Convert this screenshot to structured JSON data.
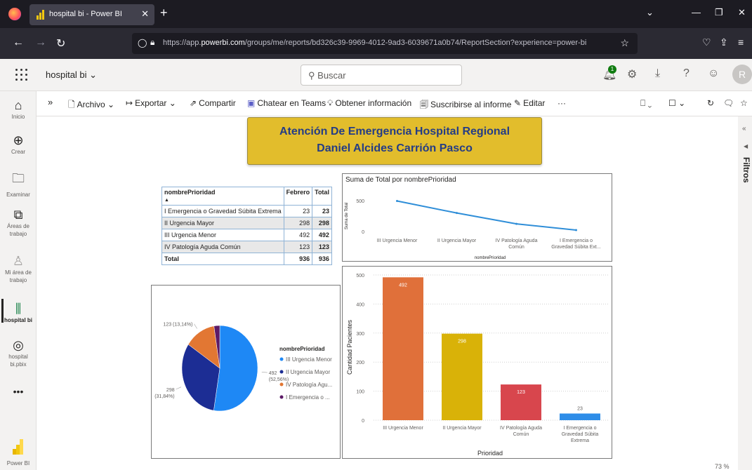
{
  "browser": {
    "tab_title": "hospital bi - Power BI",
    "url_prefix": "https://app.",
    "url_domain": "powerbi.com",
    "url_rest": "/groups/me/reports/bd326c39-9969-4012-9ad3-6039671a0b74/ReportSection?experience=power-bi"
  },
  "pbi": {
    "report_name": "hospital bi",
    "search_placeholder": "Buscar",
    "notification_count": "1",
    "avatar_initial": "R"
  },
  "leftnav": [
    {
      "label": "Inicio",
      "icon": "home-icon"
    },
    {
      "label": "Crear",
      "icon": "plus-icon"
    },
    {
      "label": "Examinar",
      "icon": "folder-icon"
    },
    {
      "label": "Áreas de trabajo",
      "icon": "workspaces-icon"
    },
    {
      "label": "Mi área de trabajo",
      "icon": "person-icon"
    },
    {
      "label": "hospital bi",
      "icon": "report-icon"
    },
    {
      "label": "hospital bi.pbix",
      "icon": "gauge-icon"
    },
    {
      "label": "Power BI",
      "icon": "powerbi-logo"
    }
  ],
  "actions": {
    "archivo": "Archivo",
    "exportar": "Exportar",
    "compartir": "Compartir",
    "teams": "Chatear en Teams",
    "insights": "Obtener información",
    "subscribe": "Suscribirse al informe",
    "edit": "Editar",
    "more": "···"
  },
  "filters_label": "Filtros",
  "report_title": {
    "line1": "Atención De Emergencia Hospital Regional",
    "line2": "Daniel Alcides Carrión Pasco"
  },
  "matrix": {
    "headers": [
      "nombrePrioridad",
      "Febrero",
      "Total"
    ],
    "rows": [
      [
        "I Emergencia o Gravedad Súbita Extrema",
        "23",
        "23"
      ],
      [
        "II Urgencia Mayor",
        "298",
        "298"
      ],
      [
        "III Urgencia Menor",
        "492",
        "492"
      ],
      [
        "IV Patología Aguda Común",
        "123",
        "123"
      ]
    ],
    "total": [
      "Total",
      "936",
      "936"
    ]
  },
  "colors": {
    "bar_iii": "#e0703a",
    "bar_ii": "#d9b208",
    "bar_iv": "#d8464d",
    "bar_i": "#2e8de8",
    "pie_iii": "#1e88f5",
    "pie_ii": "#1c2d94",
    "pie_iv": "#e27733",
    "pie_i": "#5c1a66",
    "line": "#2f8ed8"
  },
  "chart_data": [
    {
      "type": "line",
      "title": "Suma de Total por nombrePrioridad",
      "xlabel": "nombrePrioridad",
      "ylabel": "Suma de Total",
      "categories": [
        "III Urgencia Menor",
        "II Urgencia Mayor",
        "IV Patología Aguda Común",
        "I Emergencia o Gravedad Súbita Ext..."
      ],
      "values": [
        492,
        298,
        123,
        23
      ],
      "yticks": [
        "0",
        "500"
      ],
      "ylim": [
        0,
        520
      ]
    },
    {
      "type": "bar",
      "xlabel": "Prioridad",
      "ylabel": "Cantidad Pacientes",
      "categories": [
        "III Urgencia Menor",
        "II Urgencia Mayor",
        "IV Patología Aguda Común",
        "I Emergencia o Gravedad Súbita Extrema"
      ],
      "values": [
        492,
        298,
        123,
        23
      ],
      "data_labels": [
        "492",
        "298",
        "123",
        "23"
      ],
      "yticks": [
        "0",
        "100",
        "200",
        "300",
        "400",
        "500"
      ],
      "ylim": [
        0,
        500
      ]
    },
    {
      "type": "pie",
      "legend_title": "nombrePrioridad",
      "legend": [
        "III Urgencia Menor",
        "II Urgencia Mayor",
        "IV Patología Agu...",
        "I Emergencia o ..."
      ],
      "values": [
        492,
        298,
        123,
        23
      ],
      "labels": [
        "492 (52,56%)",
        "298 (31,84%)",
        "123 (13,14%)",
        ""
      ],
      "legend_position": "right"
    }
  ],
  "zoom_level": "73 %"
}
